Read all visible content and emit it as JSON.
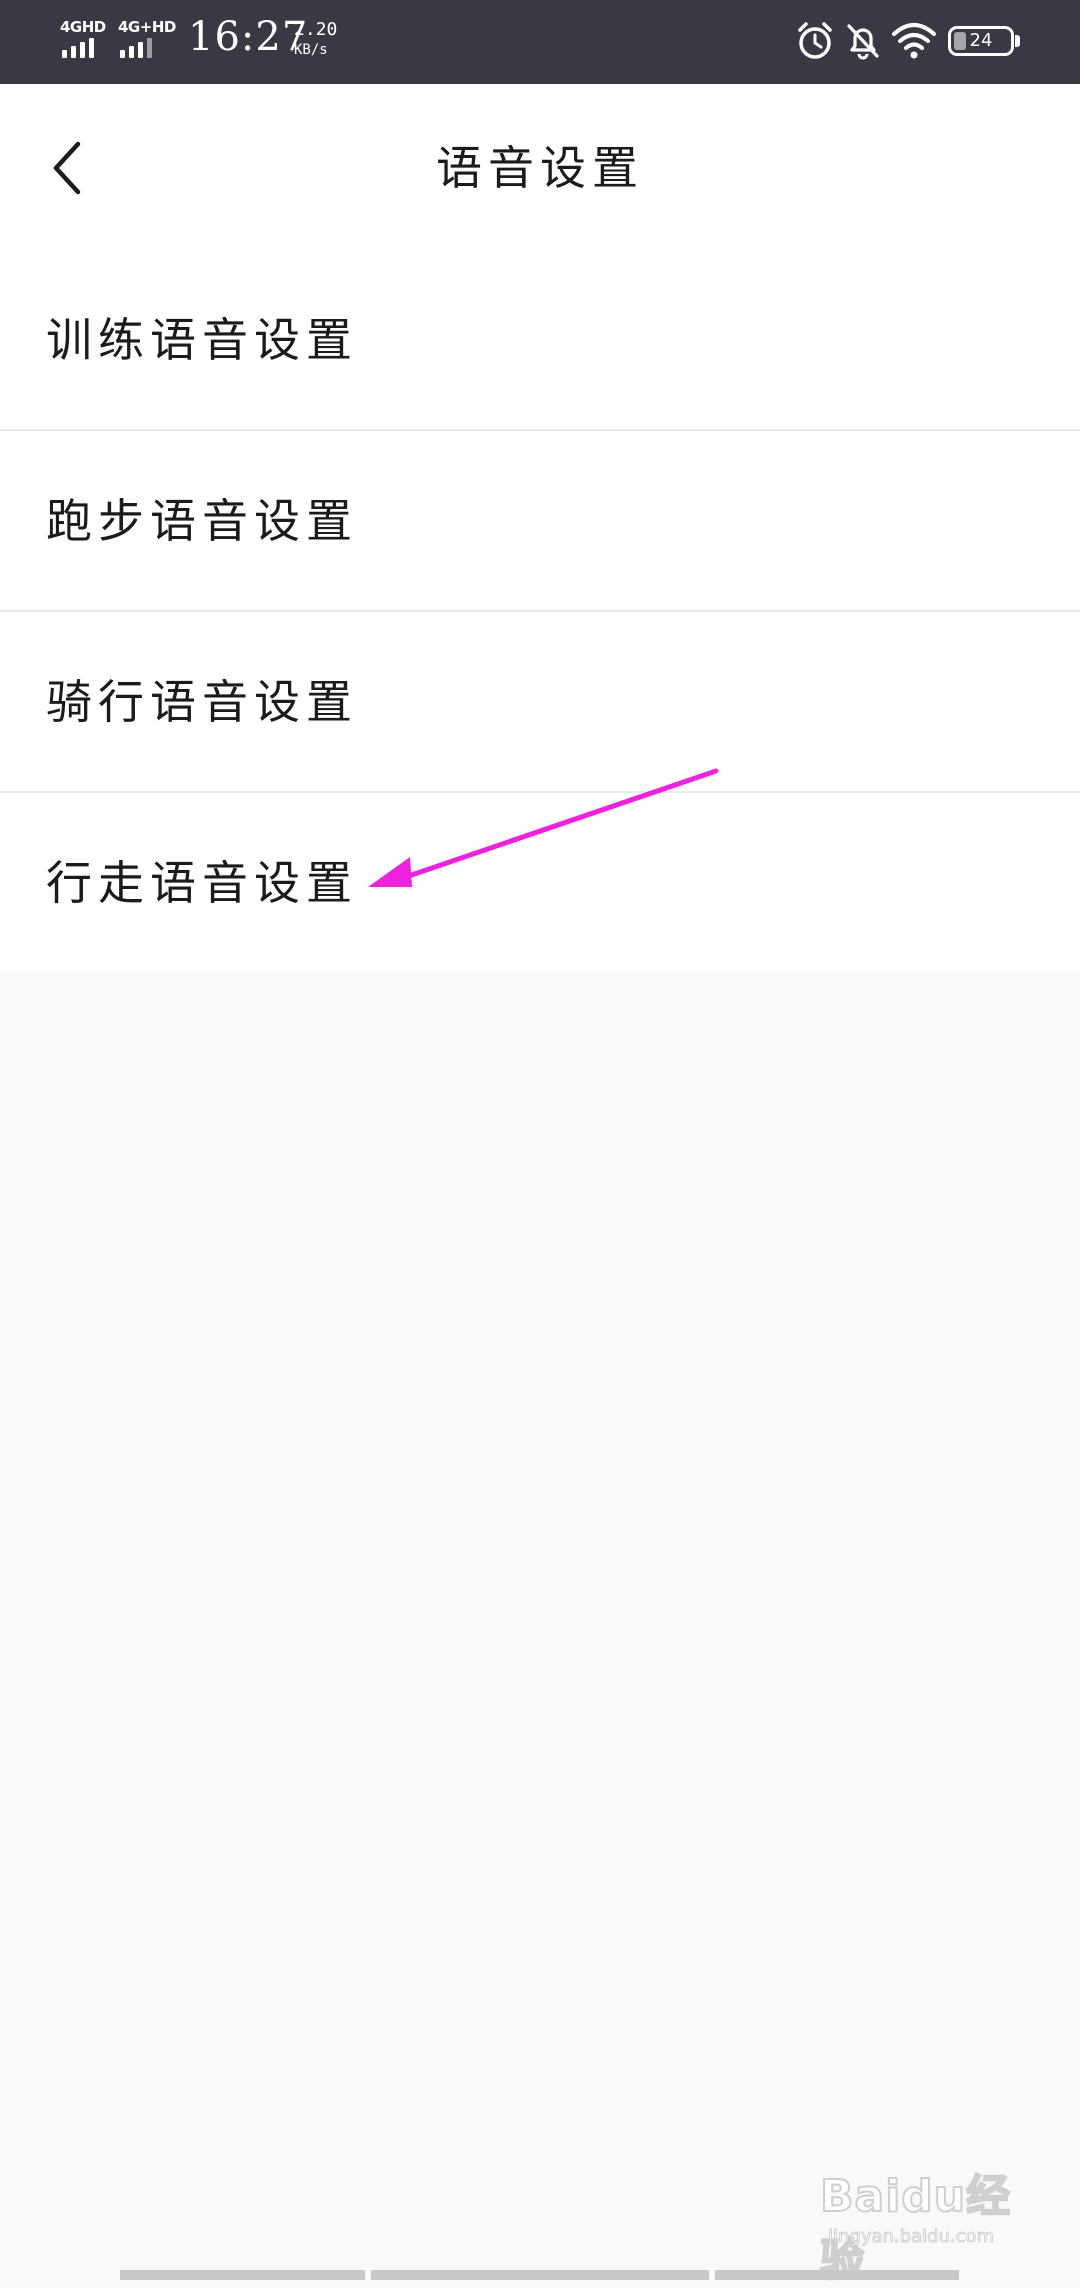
{
  "status_bar": {
    "network_1": "4GHD",
    "network_2": "4G+HD",
    "time": "16:27",
    "speed_value": "2.20",
    "speed_unit": "KB/s",
    "icons": [
      "alarm-icon",
      "bell-muted-icon",
      "wifi-icon",
      "battery-icon"
    ],
    "battery_level": "24"
  },
  "header": {
    "back_icon": "chevron-left-icon",
    "title": "语音设置"
  },
  "settings": {
    "items": [
      {
        "label": "训练语音设置"
      },
      {
        "label": "跑步语音设置"
      },
      {
        "label": "骑行语音设置"
      },
      {
        "label": "行走语音设置"
      }
    ]
  },
  "annotation": {
    "type": "arrow",
    "color": "#ee22dd",
    "target_item_index": 3
  },
  "watermark": {
    "text": "Baidu经验",
    "sub": "jingyan.baidu.com"
  },
  "colors": {
    "status_bar_bg": "#3c3744",
    "page_bg": "#f9f9f9",
    "list_bg": "#ffffff",
    "divider": "#e9e9e9",
    "text": "#1b1b1b"
  }
}
